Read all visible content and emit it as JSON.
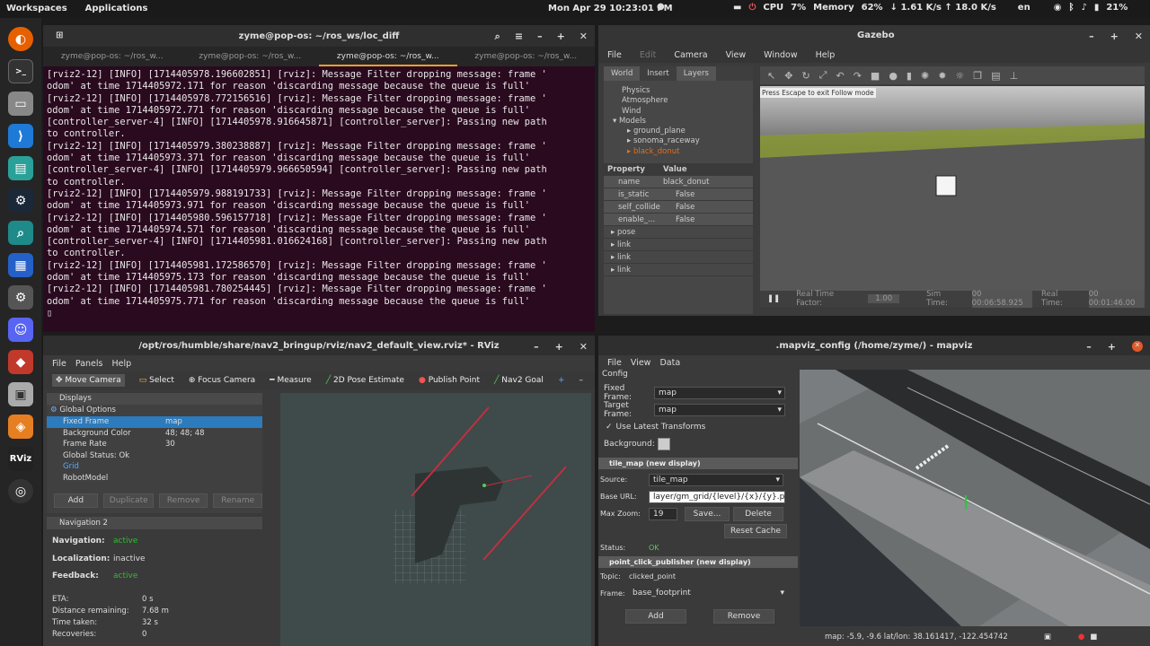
{
  "topbar": {
    "workspaces": "Workspaces",
    "applications": "Applications",
    "datetime": "Mon Apr 29 10:23:01 PM",
    "cpu_label": "CPU",
    "cpu": "7%",
    "mem_label": "Memory",
    "mem": "62%",
    "net": "↓ 1.61 K/s ↑ 18.0 K/s",
    "lang": "en",
    "battery": "21%"
  },
  "dock": {
    "items": [
      "firefox-icon",
      "terminal-icon",
      "files-icon",
      "vscode-icon",
      "software-icon",
      "steam-icon",
      "search-icon",
      "grid-icon",
      "settings-icon",
      "discord-icon",
      "app-icon",
      "usb-icon",
      "orange-icon",
      "rviz-icon",
      "obs-icon"
    ]
  },
  "terminal": {
    "title": "zyme@pop-os: ~/ros_ws/loc_diff",
    "tabs": [
      "zyme@pop-os: ~/ros_w...",
      "zyme@pop-os: ~/ros_w...",
      "zyme@pop-os: ~/ros_w...",
      "zyme@pop-os: ~/ros_w..."
    ],
    "lines": [
      "[rviz2-12] [INFO] [1714405978.196602851] [rviz]: Message Filter dropping message: frame '",
      "odom' at time 1714405972.171 for reason 'discarding message because the queue is full'",
      "[rviz2-12] [INFO] [1714405978.772156516] [rviz]: Message Filter dropping message: frame '",
      "odom' at time 1714405972.771 for reason 'discarding message because the queue is full'",
      "[controller_server-4] [INFO] [1714405978.916645871] [controller_server]: Passing new path",
      "to controller.",
      "[rviz2-12] [INFO] [1714405979.380238887] [rviz]: Message Filter dropping message: frame '",
      "odom' at time 1714405973.371 for reason 'discarding message because the queue is full'",
      "[controller_server-4] [INFO] [1714405979.966650594] [controller_server]: Passing new path",
      "to controller.",
      "[rviz2-12] [INFO] [1714405979.988191733] [rviz]: Message Filter dropping message: frame '",
      "odom' at time 1714405973.971 for reason 'discarding message because the queue is full'",
      "[rviz2-12] [INFO] [1714405980.596157718] [rviz]: Message Filter dropping message: frame '",
      "odom' at time 1714405974.571 for reason 'discarding message because the queue is full'",
      "[controller_server-4] [INFO] [1714405981.016624168] [controller_server]: Passing new path",
      "to controller.",
      "[rviz2-12] [INFO] [1714405981.172586570] [rviz]: Message Filter dropping message: frame '",
      "odom' at time 1714405975.173 for reason 'discarding message because the queue is full'",
      "[rviz2-12] [INFO] [1714405981.780254445] [rviz]: Message Filter dropping message: frame '",
      "odom' at time 1714405975.771 for reason 'discarding message because the queue is full'"
    ]
  },
  "gazebo": {
    "title": "Gazebo",
    "menu": [
      "File",
      "Edit",
      "Camera",
      "View",
      "Window",
      "Help"
    ],
    "tabs": [
      "World",
      "Insert",
      "Layers"
    ],
    "tree": [
      "Physics",
      "Atmosphere",
      "Wind",
      "Models",
      "ground_plane",
      "sonoma_raceway",
      "black_donut"
    ],
    "prop_h": "Property",
    "val_h": "Value",
    "props": [
      [
        "name",
        "black_donut"
      ],
      [
        "is_static",
        "False"
      ],
      [
        "self_collide",
        "False"
      ],
      [
        "enable_...",
        "False"
      ],
      [
        "pose",
        ""
      ],
      [
        "link",
        ""
      ],
      [
        "link",
        ""
      ],
      [
        "link",
        ""
      ]
    ],
    "hint": "Press Escape to exit Follow mode",
    "rtf_label": "Real Time Factor:",
    "rtf": "1.00",
    "sim_label": "Sim Time:",
    "sim": "00 00:06:58.925",
    "real_label": "Real Time:",
    "real": "00 00:01:46.00"
  },
  "rviz": {
    "title": "/opt/ros/humble/share/nav2_bringup/rviz/nav2_default_view.rviz* - RViz",
    "menu": [
      "File",
      "Panels",
      "Help"
    ],
    "tools": [
      "Move Camera",
      "Select",
      "Focus Camera",
      "Measure",
      "2D Pose Estimate",
      "Publish Point",
      "Nav2 Goal"
    ],
    "displays_h": "Displays",
    "global": "Global Options",
    "rows": [
      [
        "Fixed Frame",
        "map"
      ],
      [
        "Background Color",
        "48; 48; 48"
      ],
      [
        "Frame Rate",
        "30"
      ],
      [
        "Global Status: Ok",
        ""
      ],
      [
        "Grid",
        ""
      ],
      [
        "RobotModel",
        ""
      ]
    ],
    "btns": [
      "Add",
      "Duplicate",
      "Remove",
      "Rename"
    ],
    "nav_h": "Navigation 2",
    "nav": [
      [
        "Navigation:",
        "active"
      ],
      [
        "Localization:",
        "inactive"
      ],
      [
        "Feedback:",
        "active"
      ]
    ],
    "stats": [
      [
        "ETA:",
        "0 s"
      ],
      [
        "Distance remaining:",
        "7.68 m"
      ],
      [
        "Time taken:",
        "32 s"
      ],
      [
        "Recoveries:",
        "0"
      ]
    ]
  },
  "mapviz": {
    "title": ".mapviz_config (/home/zyme/) - mapviz",
    "menu": [
      "File",
      "View",
      "Data"
    ],
    "config": "Config",
    "fixed_label": "Fixed Frame:",
    "fixed": "map",
    "target_label": "Target Frame:",
    "target": "map",
    "latest": "Use Latest Transforms",
    "bg_label": "Background:",
    "tile_h": "tile_map (new display)",
    "src_label": "Source:",
    "src": "tile_map",
    "url_label": "Base URL:",
    "url": "layer/gm_grid/{level}/{x}/{y}.png",
    "zoom_label": "Max Zoom:",
    "zoom": "19",
    "save": "Save...",
    "delete": "Delete",
    "reset": "Reset Cache",
    "status_label": "Status:",
    "status": "OK",
    "pc_h": "point_click_publisher (new display)",
    "topic_label": "Topic:",
    "topic": "clicked_point",
    "frame_label": "Frame:",
    "frame": "base_footprint",
    "add": "Add",
    "remove": "Remove",
    "coords": "map: -5.9, -9.6  lat/lon: 38.161417, -122.454742"
  }
}
